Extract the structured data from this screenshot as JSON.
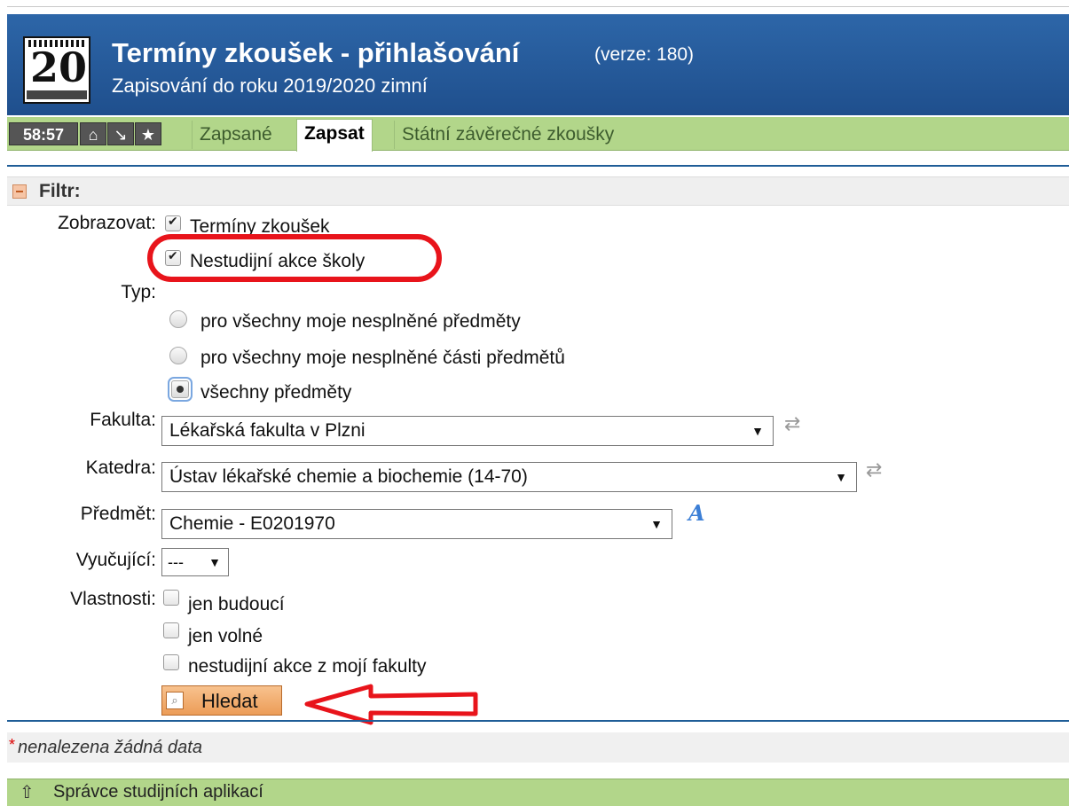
{
  "header": {
    "title": "Termíny zkoušek - přihlašování",
    "version": "(verze: 180)",
    "subtitle": "Zapisování do roku 2019/2020 zimní",
    "logo_number": "20"
  },
  "tabbar": {
    "timer": "58:57",
    "nav_icons": [
      "home-icon",
      "arrow-down-right-icon",
      "star-icon"
    ],
    "tabs": [
      {
        "label": "Zapsané",
        "active": false
      },
      {
        "label": "Zapsat",
        "active": true
      },
      {
        "label": "Státní závěrečné zkoušky",
        "active": false
      }
    ]
  },
  "filter": {
    "title": "Filtr:",
    "zobrazovat_label": "Zobrazovat:",
    "zobrazovat_options": [
      {
        "label": "Termíny zkoušek",
        "checked": true
      },
      {
        "label": "Nestudijní akce školy",
        "checked": true
      }
    ],
    "typ_label": "Typ:",
    "typ_options": [
      {
        "label": "pro všechny moje nesplněné předměty",
        "selected": false
      },
      {
        "label": "pro všechny moje nesplněné části předmětů",
        "selected": false
      },
      {
        "label": "všechny předměty",
        "selected": true
      }
    ],
    "fakulta_label": "Fakulta:",
    "fakulta_value": "Lékařská fakulta v Plzni",
    "katedra_label": "Katedra:",
    "katedra_value": "Ústav lékařské chemie a biochemie (14-70)",
    "predmet_label": "Předmět:",
    "predmet_value": "Chemie - E0201970",
    "vyucujici_label": "Vyučující:",
    "vyucujici_value": "---",
    "vlastnosti_label": "Vlastnosti:",
    "vlastnosti_options": [
      {
        "label": "jen budoucí",
        "checked": false
      },
      {
        "label": "jen volné",
        "checked": false
      },
      {
        "label": "nestudijní akce z mojí fakulty",
        "checked": false
      }
    ],
    "search_button": "Hledat"
  },
  "results": {
    "marker": "*",
    "message": "nenalezena žádná data"
  },
  "footer": {
    "label": "Správce studijních aplikací"
  },
  "colors": {
    "header_blue": "#2d66a8",
    "tab_green": "#b2d68a",
    "annotation_red": "#e8141b",
    "button_orange": "#ec9c57"
  }
}
